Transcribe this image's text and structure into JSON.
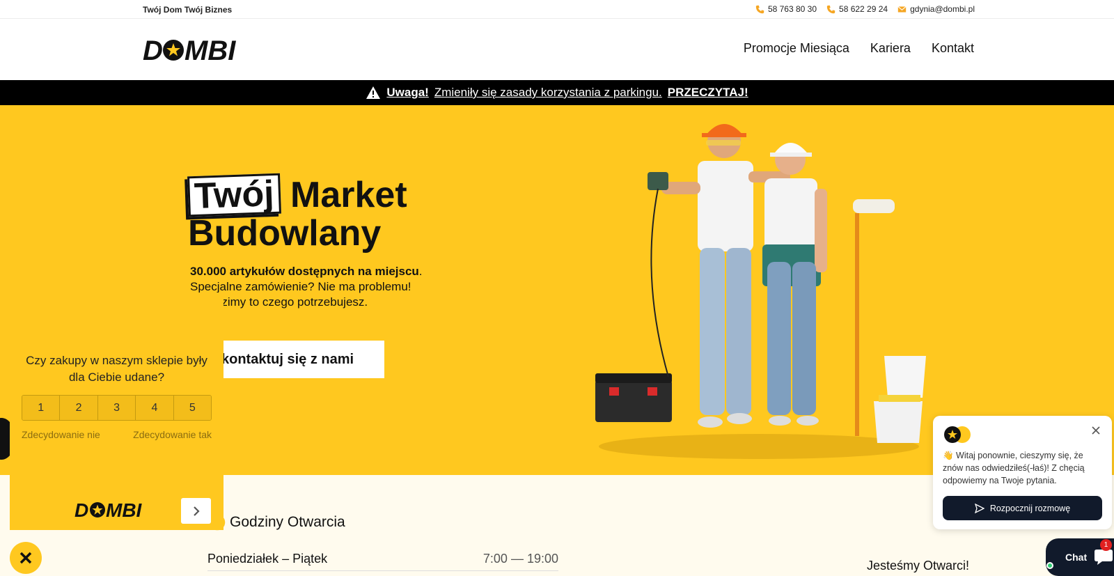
{
  "topbar": {
    "tagline": "Twój Dom Twój Biznes",
    "phone1": "58 763 80 30",
    "phone2": "58 622 29 24",
    "email": "gdynia@dombi.pl"
  },
  "header": {
    "logo_text": "DOMBI",
    "nav": [
      "Promocje Miesiąca",
      "Kariera",
      "Kontakt"
    ]
  },
  "alert": {
    "label": "Uwaga!",
    "text": "Zmieniły się zasady korzystania z parkingu.",
    "link": "PRZECZYTAJ!"
  },
  "hero": {
    "title_boxed": "Twój",
    "title_rest": "Market",
    "title_line2": "Budowlany",
    "text_bold": "30.000 artykułów dostępnych na miejscu",
    "text_dot": ".",
    "text_line2": "Specjalne zamówienie? Nie ma problemu!",
    "text_line3": "...wadzimy to czego potrzebujesz.",
    "cta": "kontaktuj się z nami"
  },
  "hours": {
    "title": "Godziny Otwarcia",
    "rows": [
      {
        "day": "Poniedziałek – Piątek",
        "time": "7:00 — 19:00"
      }
    ],
    "open_label": "Jesteśmy Otwarci!"
  },
  "survey": {
    "question": "Czy zakupy w naszym sklepie były dla Ciebie udane?",
    "options": [
      "1",
      "2",
      "3",
      "4",
      "5"
    ],
    "label_low": "Zdecydowanie nie",
    "label_high": "Zdecydowanie tak",
    "logo_text": "DOMBI"
  },
  "chat": {
    "message": "👋 Witaj ponownie, cieszymy się, że znów nas odwiedziłeś(-łaś)! Z chęcią odpowiemy na Twoje pytania.",
    "start_button": "Rozpocznij rozmowę",
    "launcher_label": "Chat",
    "badge_count": "1"
  },
  "colors": {
    "brand_yellow": "#ffc81f",
    "dark_navy": "#111a2b",
    "alert_bg": "#000000"
  }
}
